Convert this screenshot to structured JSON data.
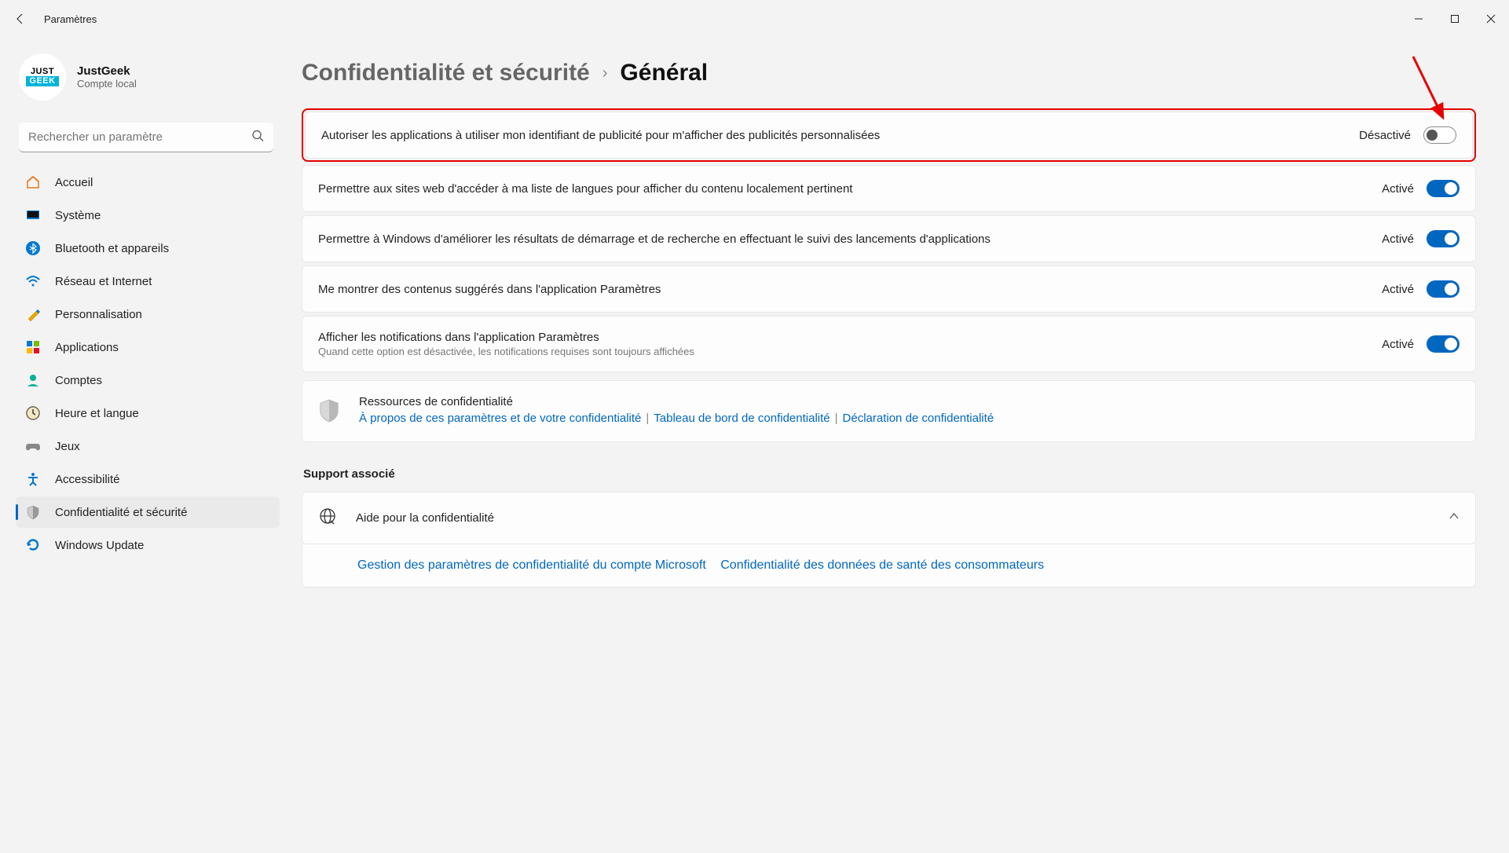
{
  "titlebar": {
    "title": "Paramètres"
  },
  "profile": {
    "name": "JustGeek",
    "sub": "Compte local"
  },
  "search": {
    "placeholder": "Rechercher un paramètre"
  },
  "nav": {
    "home": "Accueil",
    "system": "Système",
    "bluetooth": "Bluetooth et appareils",
    "network": "Réseau et Internet",
    "personalization": "Personnalisation",
    "apps": "Applications",
    "accounts": "Comptes",
    "time": "Heure et langue",
    "gaming": "Jeux",
    "accessibility": "Accessibilité",
    "privacy": "Confidentialité et sécurité",
    "update": "Windows Update"
  },
  "breadcrumb": {
    "parent": "Confidentialité et sécurité",
    "sep": "›",
    "current": "Général"
  },
  "status": {
    "on": "Activé",
    "off": "Désactivé"
  },
  "settings": {
    "ad_id": "Autoriser les applications à utiliser mon identifiant de publicité pour m'afficher des publicités personnalisées",
    "lang_list": "Permettre aux sites web d'accéder à ma liste de langues pour afficher du contenu localement pertinent",
    "track_launch": "Permettre à Windows d'améliorer les résultats de démarrage et de recherche en effectuant le suivi des lancements d'applications",
    "suggested": "Me montrer des contenus suggérés dans l'application Paramètres",
    "notifs": "Afficher les notifications dans l'application Paramètres",
    "notifs_sub": "Quand cette option est désactivée, les notifications requises sont toujours affichées"
  },
  "resources": {
    "title": "Ressources de confidentialité",
    "link1": "À propos de ces paramètres et de votre confidentialité",
    "link2": "Tableau de bord de confidentialité",
    "link3": "Déclaration de confidentialité"
  },
  "support": {
    "title": "Support associé",
    "help_privacy": "Aide pour la confidentialité",
    "link1": "Gestion des paramètres de confidentialité du compte Microsoft",
    "link2": "Confidentialité des données de santé des consommateurs"
  }
}
